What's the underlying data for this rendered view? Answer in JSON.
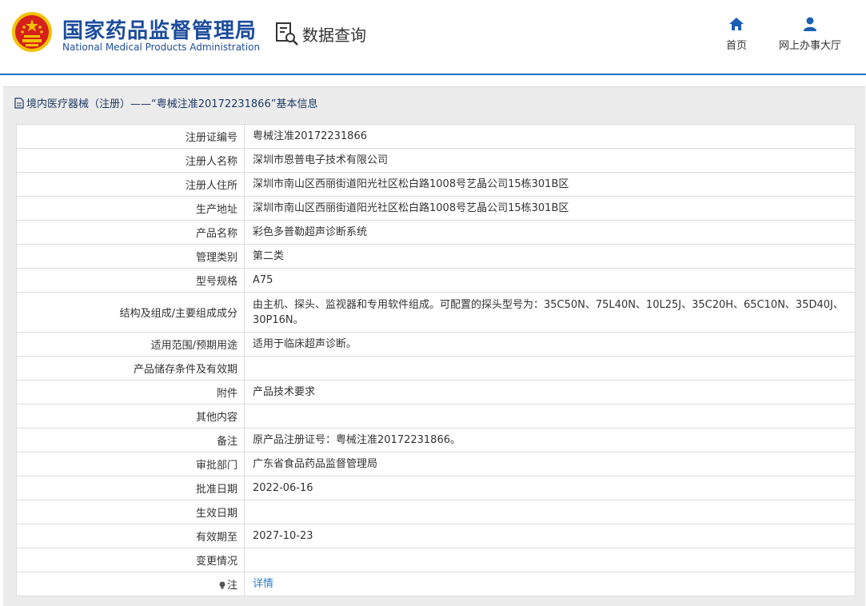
{
  "header": {
    "org_cn": "国家药品监督管理局",
    "org_en": "National Medical Products Administration",
    "query_label": "数据查询",
    "nav": {
      "home": "首页",
      "service_hall": "网上办事大厅"
    }
  },
  "panel": {
    "title": "境内医疗器械（注册）——“粤械注准20172231866”基本信息"
  },
  "rows": [
    {
      "label": "注册证编号",
      "value": "粤械注准20172231866"
    },
    {
      "label": "注册人名称",
      "value": "深圳市恩普电子技术有限公司"
    },
    {
      "label": "注册人住所",
      "value": "深圳市南山区西丽街道阳光社区松白路1008号艺晶公司15栋301B区"
    },
    {
      "label": "生产地址",
      "value": "深圳市南山区西丽街道阳光社区松白路1008号艺晶公司15栋301B区"
    },
    {
      "label": "产品名称",
      "value": "彩色多普勒超声诊断系统"
    },
    {
      "label": "管理类别",
      "value": "第二类"
    },
    {
      "label": "型号规格",
      "value": "A75"
    },
    {
      "label": "结构及组成/主要组成成分",
      "value": "由主机、探头、监视器和专用软件组成。可配置的探头型号为：35C50N、75L40N、10L25J、35C20H、65C10N、35D40J、30P16N。"
    },
    {
      "label": "适用范围/预期用途",
      "value": "适用于临床超声诊断。"
    },
    {
      "label": "产品储存条件及有效期",
      "value": ""
    },
    {
      "label": "附件",
      "value": "产品技术要求"
    },
    {
      "label": "其他内容",
      "value": ""
    },
    {
      "label": "备注",
      "value": "原产品注册证号：粤械注准20172231866。"
    },
    {
      "label": "审批部门",
      "value": "广东省食品药品监督管理局"
    },
    {
      "label": "批准日期",
      "value": "2022-06-16"
    },
    {
      "label": "生效日期",
      "value": ""
    },
    {
      "label": "有效期至",
      "value": "2027-10-23"
    },
    {
      "label": "变更情况",
      "value": ""
    },
    {
      "label": "注",
      "value": "详情"
    }
  ],
  "colors": {
    "brand_blue": "#1d4c9c",
    "link_blue": "#2a7bd0",
    "panel_bg": "#ececec",
    "emblem_red": "#d5201b",
    "emblem_gold": "#f2c200"
  },
  "icons": {
    "emblem": "national-emblem-icon",
    "query": "search-document-icon",
    "home": "home-icon",
    "hall": "user-icon",
    "title": "document-icon",
    "note": "lightbulb-icon"
  }
}
